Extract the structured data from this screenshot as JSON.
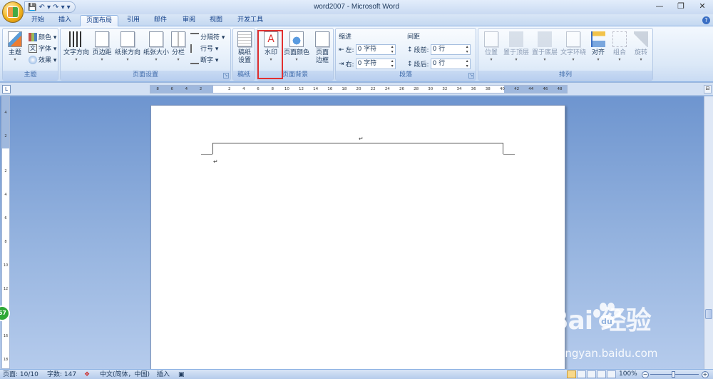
{
  "window": {
    "title": "word2007 - Microsoft Word",
    "minimize": "—",
    "restore": "❐",
    "close": "✕",
    "help": "?"
  },
  "qat": {
    "save": "💾",
    "undo": "↶ ▾",
    "redo": "↷ ▾",
    "more": "▾"
  },
  "tabs": [
    "开始",
    "插入",
    "页面布局",
    "引用",
    "邮件",
    "审阅",
    "视图",
    "开发工具"
  ],
  "active_tab": "页面布局",
  "ribbon": {
    "theme_group": {
      "label": "主题",
      "theme_btn": "主题",
      "colors": "颜色 ▾",
      "fonts": "字体 ▾",
      "effects": "效果 ▾"
    },
    "page_setup_group": {
      "label": "页面设置",
      "text_direction": "文字方向",
      "margins": "页边距",
      "orientation": "纸张方向",
      "size": "纸张大小",
      "columns": "分栏",
      "breaks": "分隔符 ▾",
      "line_numbers": "行号 ▾",
      "hyphenation": "断字 ▾"
    },
    "manuscript_group": {
      "label": "稿纸",
      "paper_setup_l1": "稿纸",
      "paper_setup_l2": "设置"
    },
    "page_background_group": {
      "label": "页面背景",
      "watermark": "水印",
      "page_color": "页面颜色",
      "borders_l1": "页面",
      "borders_l2": "边框"
    },
    "paragraph_group": {
      "label": "段落",
      "indent_title": "缩进",
      "left_label": "左:",
      "left_value": "0 字符",
      "right_label": "右:",
      "right_value": "0 字符",
      "spacing_title": "间距",
      "before_label": "段前:",
      "before_value": "0 行",
      "after_label": "段后:",
      "after_value": "0 行"
    },
    "arrange_group": {
      "label": "排列",
      "position": "位置",
      "bring_front": "置于顶层",
      "send_back": "置于底层",
      "text_wrap": "文字环绕",
      "align": "对齐",
      "group": "组合",
      "rotate": "旋转"
    }
  },
  "ruler": {
    "corner": "L",
    "ticks": [
      "8",
      "6",
      "4",
      "2",
      "",
      "2",
      "4",
      "6",
      "8",
      "10",
      "12",
      "14",
      "16",
      "18",
      "20",
      "22",
      "24",
      "26",
      "28",
      "30",
      "32",
      "34",
      "36",
      "38",
      "40",
      "42",
      "44",
      "46",
      "48"
    ],
    "vticks": [
      "",
      "4",
      "",
      "2",
      "",
      "",
      "2",
      "",
      "4",
      "",
      "6",
      "",
      "8",
      "",
      "10",
      "",
      "12",
      "",
      "14",
      "",
      "16",
      "",
      "18"
    ]
  },
  "document": {
    "mark1": "↵",
    "mark2": "↵"
  },
  "badge": "67",
  "status": {
    "page": "页面: 10/10",
    "words": "字数: 147",
    "lang": "中文(简体，中国)",
    "mode": "插入",
    "zoom": "100%",
    "zoom_minus": "−",
    "zoom_plus": "+"
  },
  "watermark": {
    "main": "Bai  经验",
    "sub": "jingyan.baidu.com"
  }
}
